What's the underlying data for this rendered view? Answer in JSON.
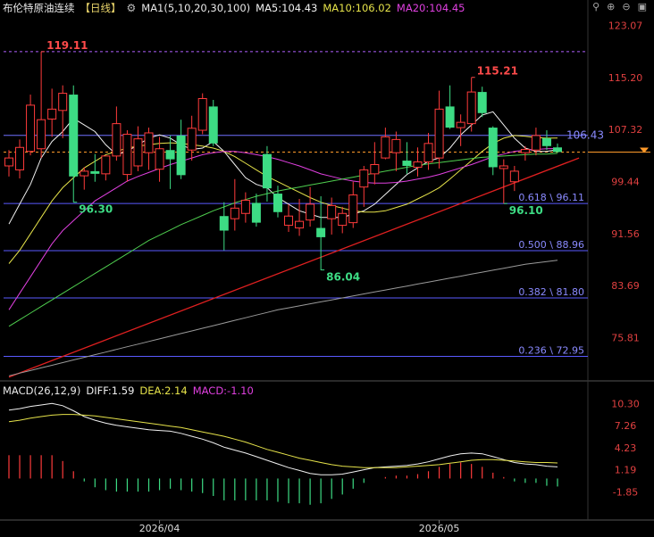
{
  "header": {
    "title": "布伦特原油连续",
    "period": "【日线】",
    "ma_label": "MA1(5,10,20,30,100)",
    "ma5": "MA5:104.43",
    "ma10": "MA10:106.02",
    "ma20": "MA20:104.45",
    "colors": {
      "ma5": "#f0f0f0",
      "ma10": "#e6e34a",
      "ma20": "#e040e0",
      "ma30": "#4fcf4f",
      "ma100": "#9a9a9a"
    }
  },
  "macd_header": {
    "label": "MACD(26,12,9)",
    "diff": "DIFF:1.59",
    "dea": "DEA:2.14",
    "macd": "MACD:-1.10"
  },
  "chart_data": {
    "type": "candlestick",
    "price_axis": {
      "ticks": [
        123.07,
        115.2,
        107.32,
        99.44,
        91.56,
        83.69,
        75.81
      ],
      "range": [
        69.5,
        124.5
      ]
    },
    "macd_axis": {
      "ticks": [
        10.3,
        7.26,
        4.23,
        1.19,
        -1.85
      ],
      "range": [
        -3.5,
        11.2
      ]
    },
    "x_labels": [
      {
        "label": "2026/04",
        "index": 14
      },
      {
        "label": "2026/05",
        "index": 40
      }
    ],
    "last_price": 103.9,
    "last_price_label": "106.43",
    "up_color": "#ff3b3b",
    "down_color": "#3ddc84",
    "candles": [
      {
        "o": 101.8,
        "h": 104.2,
        "l": 100.2,
        "c": 103.0
      },
      {
        "o": 101.2,
        "h": 105.8,
        "l": 99.9,
        "c": 104.6
      },
      {
        "o": 104.0,
        "h": 112.6,
        "l": 103.4,
        "c": 111.0
      },
      {
        "o": 104.4,
        "h": 119.1,
        "l": 103.0,
        "c": 108.8
      },
      {
        "o": 108.9,
        "h": 113.5,
        "l": 106.2,
        "c": 110.4
      },
      {
        "o": 110.2,
        "h": 114.0,
        "l": 106.0,
        "c": 112.8
      },
      {
        "o": 112.6,
        "h": 114.0,
        "l": 96.3,
        "c": 100.2
      },
      {
        "o": 100.3,
        "h": 101.6,
        "l": 98.2,
        "c": 101.0
      },
      {
        "o": 101.0,
        "h": 103.6,
        "l": 99.4,
        "c": 100.6
      },
      {
        "o": 100.6,
        "h": 103.2,
        "l": 99.6,
        "c": 103.3
      },
      {
        "o": 103.3,
        "h": 110.8,
        "l": 102.6,
        "c": 108.2
      },
      {
        "o": 100.5,
        "h": 107.2,
        "l": 99.4,
        "c": 106.6
      },
      {
        "o": 101.8,
        "h": 107.8,
        "l": 101.0,
        "c": 105.9
      },
      {
        "o": 103.8,
        "h": 107.6,
        "l": 101.2,
        "c": 106.8
      },
      {
        "o": 101.3,
        "h": 106.2,
        "l": 99.4,
        "c": 104.4
      },
      {
        "o": 104.2,
        "h": 106.4,
        "l": 98.3,
        "c": 102.8
      },
      {
        "o": 106.4,
        "h": 108.8,
        "l": 99.8,
        "c": 100.4
      },
      {
        "o": 104.2,
        "h": 109.4,
        "l": 102.6,
        "c": 107.5
      },
      {
        "o": 107.2,
        "h": 112.8,
        "l": 106.6,
        "c": 112.0
      },
      {
        "o": 110.8,
        "h": 111.8,
        "l": 104.8,
        "c": 105.2
      },
      {
        "o": 94.2,
        "h": 96.3,
        "l": 89.0,
        "c": 92.0
      },
      {
        "o": 93.8,
        "h": 99.8,
        "l": 92.0,
        "c": 95.4
      },
      {
        "o": 94.6,
        "h": 97.8,
        "l": 93.2,
        "c": 96.6
      },
      {
        "o": 96.2,
        "h": 97.6,
        "l": 92.6,
        "c": 93.2
      },
      {
        "o": 103.6,
        "h": 104.8,
        "l": 96.4,
        "c": 98.4
      },
      {
        "o": 97.6,
        "h": 98.8,
        "l": 94.0,
        "c": 94.8
      },
      {
        "o": 92.8,
        "h": 96.0,
        "l": 91.8,
        "c": 94.2
      },
      {
        "o": 92.4,
        "h": 96.8,
        "l": 91.2,
        "c": 93.4
      },
      {
        "o": 93.6,
        "h": 98.6,
        "l": 92.6,
        "c": 96.0
      },
      {
        "o": 92.4,
        "h": 97.2,
        "l": 86.0,
        "c": 91.0
      },
      {
        "o": 93.8,
        "h": 97.0,
        "l": 91.4,
        "c": 95.8
      },
      {
        "o": 92.8,
        "h": 95.6,
        "l": 91.6,
        "c": 94.6
      },
      {
        "o": 93.2,
        "h": 99.4,
        "l": 92.4,
        "c": 97.4
      },
      {
        "o": 98.6,
        "h": 101.8,
        "l": 95.6,
        "c": 101.2
      },
      {
        "o": 100.6,
        "h": 105.4,
        "l": 99.0,
        "c": 102.0
      },
      {
        "o": 103.0,
        "h": 107.6,
        "l": 102.8,
        "c": 106.2
      },
      {
        "o": 103.8,
        "h": 107.0,
        "l": 101.0,
        "c": 105.8
      },
      {
        "o": 102.6,
        "h": 105.4,
        "l": 100.6,
        "c": 101.8
      },
      {
        "o": 101.6,
        "h": 104.6,
        "l": 100.2,
        "c": 102.4
      },
      {
        "o": 102.4,
        "h": 106.8,
        "l": 101.2,
        "c": 105.2
      },
      {
        "o": 103.0,
        "h": 113.2,
        "l": 101.4,
        "c": 110.4
      },
      {
        "o": 110.8,
        "h": 114.0,
        "l": 107.4,
        "c": 107.6
      },
      {
        "o": 107.6,
        "h": 109.6,
        "l": 104.8,
        "c": 108.4
      },
      {
        "o": 108.2,
        "h": 115.2,
        "l": 107.0,
        "c": 113.0
      },
      {
        "o": 113.0,
        "h": 113.8,
        "l": 109.2,
        "c": 109.8
      },
      {
        "o": 107.6,
        "h": 107.8,
        "l": 100.4,
        "c": 101.6
      },
      {
        "o": 101.4,
        "h": 102.8,
        "l": 96.1,
        "c": 101.8
      },
      {
        "o": 99.4,
        "h": 101.8,
        "l": 98.0,
        "c": 101.0
      },
      {
        "o": 103.8,
        "h": 104.8,
        "l": 102.6,
        "c": 104.3
      },
      {
        "o": 104.2,
        "h": 107.6,
        "l": 103.4,
        "c": 106.4
      },
      {
        "o": 106.0,
        "h": 107.2,
        "l": 104.2,
        "c": 104.8
      },
      {
        "o": 104.6,
        "h": 105.2,
        "l": 103.8,
        "c": 103.9
      }
    ],
    "ma_series": [
      {
        "name": "MA5",
        "color": "#f0f0f0",
        "values": [
          93,
          96,
          99,
          103,
          105.5,
          107,
          109,
          108,
          107,
          105,
          103.5,
          104,
          105,
          106,
          106.5,
          106,
          105,
          104.3,
          104.5,
          105.5,
          104,
          102,
          100,
          99,
          98.5,
          97,
          96,
          95,
          94.5,
          94,
          94,
          94,
          94.5,
          95,
          96,
          97.5,
          99,
          100.5,
          101.5,
          102.5,
          103,
          104.5,
          106.5,
          108,
          109.5,
          110,
          108,
          106,
          104.5,
          104,
          104,
          104.3
        ]
      },
      {
        "name": "MA10",
        "color": "#e6e34a",
        "values": [
          87,
          89,
          91.5,
          94,
          96.5,
          98.5,
          100,
          101.5,
          102.5,
          103.5,
          104,
          104.5,
          104.8,
          105,
          105.2,
          105.3,
          105.2,
          105,
          104.8,
          104.5,
          104,
          103.2,
          102.2,
          101.2,
          100.2,
          99.4,
          98.6,
          97.8,
          97,
          96.3,
          95.8,
          95.4,
          95,
          94.8,
          94.8,
          95,
          95.5,
          96,
          96.8,
          97.6,
          98.5,
          99.8,
          101.2,
          102.6,
          104,
          105.2,
          106,
          106.4,
          106.3,
          106.1,
          106,
          106.02
        ]
      },
      {
        "name": "MA20",
        "color": "#e040e0",
        "values": [
          80,
          82.5,
          85,
          87.5,
          90,
          92,
          93.5,
          95,
          96.5,
          97.5,
          98.5,
          99.5,
          100.2,
          100.8,
          101.4,
          102,
          102.5,
          103,
          103.5,
          103.8,
          104,
          104,
          103.8,
          103.5,
          103.2,
          102.8,
          102.3,
          101.8,
          101.2,
          100.6,
          100.2,
          99.8,
          99.5,
          99.3,
          99.2,
          99.2,
          99.3,
          99.5,
          99.8,
          100.1,
          100.5,
          101,
          101.5,
          102,
          102.6,
          103.2,
          103.6,
          104,
          104.2,
          104.3,
          104.4,
          104.45
        ]
      },
      {
        "name": "MA30",
        "color": "#4fcf4f",
        "values": [
          77.5,
          78.5,
          79.5,
          80.5,
          81.5,
          82.5,
          83.5,
          84.5,
          85.5,
          86.5,
          87.5,
          88.5,
          89.5,
          90.5,
          91.3,
          92.1,
          92.9,
          93.6,
          94.3,
          95,
          95.6,
          96.2,
          96.7,
          97.2,
          97.6,
          98,
          98.3,
          98.6,
          98.9,
          99.2,
          99.5,
          99.8,
          100.1,
          100.4,
          100.7,
          101,
          101.3,
          101.6,
          101.9,
          102.1,
          102.3,
          102.5,
          102.7,
          102.9,
          103.1,
          103.2,
          103.3,
          103.4,
          103.5,
          103.6,
          103.6,
          103.7
        ]
      },
      {
        "name": "MA100",
        "color": "#9a9a9a",
        "values": [
          70,
          70.4,
          70.8,
          71.2,
          71.6,
          72,
          72.4,
          72.8,
          73.2,
          73.6,
          74,
          74.4,
          74.8,
          75.2,
          75.6,
          76,
          76.4,
          76.8,
          77.2,
          77.6,
          78,
          78.4,
          78.8,
          79.2,
          79.6,
          80,
          80.3,
          80.6,
          80.9,
          81.2,
          81.5,
          81.8,
          82.1,
          82.4,
          82.7,
          83,
          83.3,
          83.6,
          83.9,
          84.2,
          84.5,
          84.8,
          85.1,
          85.4,
          85.7,
          86,
          86.3,
          86.6,
          86.9,
          87.1,
          87.3,
          87.5
        ]
      }
    ],
    "fib_levels": [
      {
        "price": 96.11,
        "label": "0.618 \\ 96.11"
      },
      {
        "price": 88.96,
        "label": "0.500 \\ 88.96"
      },
      {
        "price": 81.8,
        "label": "0.382 \\ 81.80"
      },
      {
        "price": 72.95,
        "label": "0.236 \\ 72.95"
      }
    ],
    "ref_lines": [
      {
        "price": 119.11,
        "style": "dashed",
        "color": "#b060ff"
      },
      {
        "price": 106.43,
        "style": "solid",
        "color": "#7070ff"
      },
      {
        "price": 103.9,
        "style": "dashed",
        "color": "#ff9a2a"
      }
    ],
    "trendline": {
      "from": {
        "index": 0,
        "price": 69.8
      },
      "to": {
        "index": 53,
        "price": 103.0
      },
      "color": "#e02020"
    },
    "annotations": [
      {
        "text": "119.11",
        "index": 3,
        "price": 119.11,
        "color": "#ff4a4a"
      },
      {
        "text": "96.30",
        "index": 6,
        "price": 96.3,
        "color": "#3ddc84"
      },
      {
        "text": "86.04",
        "index": 29,
        "price": 86.04,
        "color": "#3ddc84"
      },
      {
        "text": "115.21",
        "index": 43,
        "price": 115.21,
        "color": "#ff4a4a"
      },
      {
        "text": "96.10",
        "index": 46,
        "price": 96.1,
        "color": "#3ddc84"
      },
      {
        "text": "106.43",
        "index": 51,
        "price": 106.43,
        "color": "#8a8aff"
      }
    ],
    "macd": {
      "diff": [
        9.4,
        9.6,
        9.9,
        10.1,
        10.3,
        10.0,
        9.3,
        8.5,
        8.0,
        7.6,
        7.3,
        7.1,
        6.9,
        6.7,
        6.6,
        6.5,
        6.2,
        5.8,
        5.4,
        4.9,
        4.3,
        3.9,
        3.5,
        3.0,
        2.5,
        2.0,
        1.5,
        1.1,
        0.7,
        0.5,
        0.5,
        0.6,
        0.9,
        1.2,
        1.5,
        1.6,
        1.7,
        1.8,
        2.0,
        2.3,
        2.7,
        3.1,
        3.4,
        3.5,
        3.4,
        3.0,
        2.6,
        2.2,
        2.0,
        1.9,
        1.7,
        1.59
      ],
      "dea": [
        7.8,
        8.0,
        8.3,
        8.5,
        8.7,
        8.8,
        8.8,
        8.7,
        8.6,
        8.4,
        8.2,
        8.0,
        7.8,
        7.6,
        7.4,
        7.2,
        7.0,
        6.7,
        6.4,
        6.1,
        5.8,
        5.4,
        5.0,
        4.5,
        4.0,
        3.6,
        3.2,
        2.8,
        2.5,
        2.2,
        1.9,
        1.7,
        1.6,
        1.5,
        1.5,
        1.5,
        1.5,
        1.6,
        1.7,
        1.8,
        1.9,
        2.1,
        2.3,
        2.5,
        2.6,
        2.6,
        2.5,
        2.4,
        2.3,
        2.2,
        2.2,
        2.14
      ],
      "hist": [
        3.2,
        3.2,
        3.2,
        3.2,
        3.2,
        2.4,
        1.0,
        -0.4,
        -1.2,
        -1.6,
        -1.8,
        -1.8,
        -1.8,
        -1.8,
        -1.6,
        -1.4,
        -1.6,
        -1.8,
        -2.0,
        -2.4,
        -3.0,
        -3.0,
        -3.0,
        -3.0,
        -3.0,
        -3.2,
        -3.4,
        -3.4,
        -3.6,
        -3.4,
        -2.8,
        -2.2,
        -1.4,
        -0.6,
        0.0,
        0.2,
        0.4,
        0.4,
        0.6,
        1.0,
        1.6,
        2.0,
        2.2,
        2.0,
        1.6,
        0.8,
        0.2,
        -0.4,
        -0.6,
        -0.6,
        -1.0,
        -1.1
      ]
    }
  }
}
